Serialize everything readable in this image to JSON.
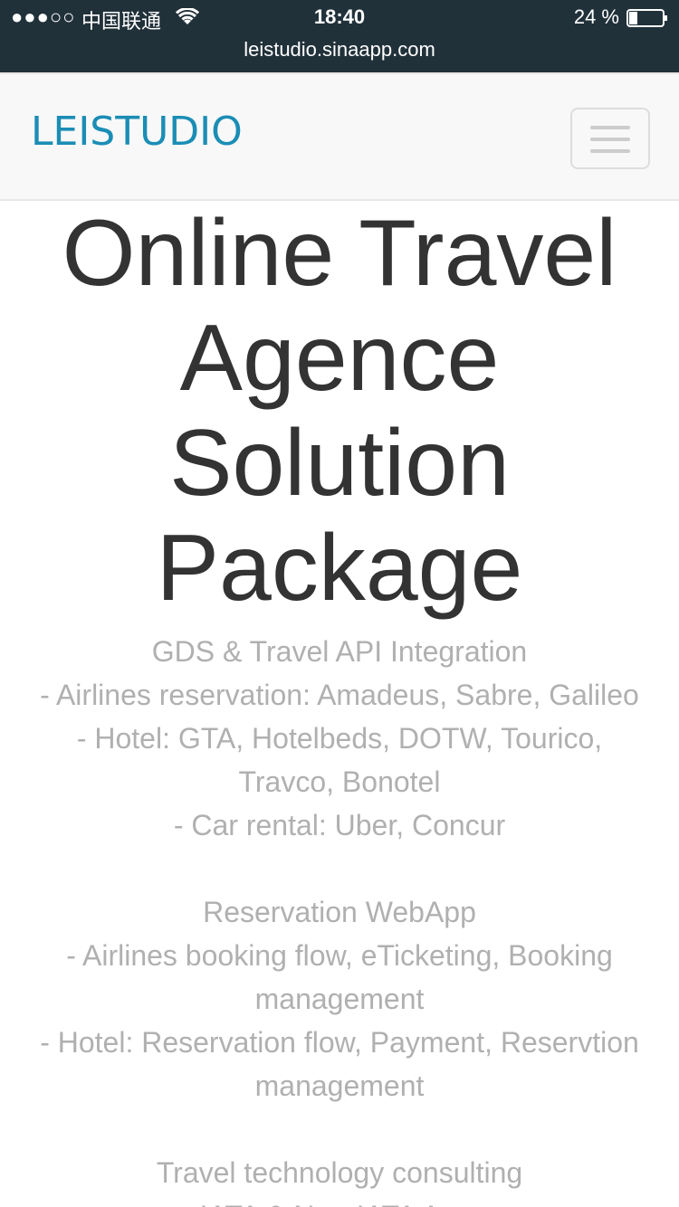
{
  "status_bar": {
    "signal": "●●●○○",
    "carrier": "中国联通",
    "time": "18:40",
    "battery": "24 %",
    "url": "leistudio.sinaapp.com"
  },
  "navbar": {
    "brand": "LEISTUDIO",
    "menu_icon": "hamburger-icon"
  },
  "hero": {
    "title": "Online Travel Agence Solution Package"
  },
  "sections": [
    {
      "heading": "GDS & Travel API Integration",
      "lines": [
        "- Airlines reservation: Amadeus, Sabre, Galileo",
        "- Hotel: GTA, Hotelbeds, DOTW, Tourico, Travco, Bonotel",
        "- Car rental: Uber, Concur"
      ]
    },
    {
      "heading": "Reservation WebApp",
      "lines": [
        "- Airlines booking flow, eTicketing, Booking management",
        "- Hotel: Reservation flow, Payment, Reservtion management"
      ]
    },
    {
      "heading": "Travel technology consulting",
      "lines": [
        "- IATA & Non-IATA Agent"
      ]
    }
  ],
  "colors": {
    "status_bg": "#21313a",
    "navbar_bg": "#f8f8f8",
    "brand": "#1b8db5",
    "title": "#333333",
    "body_text": "#b0b0b0"
  }
}
